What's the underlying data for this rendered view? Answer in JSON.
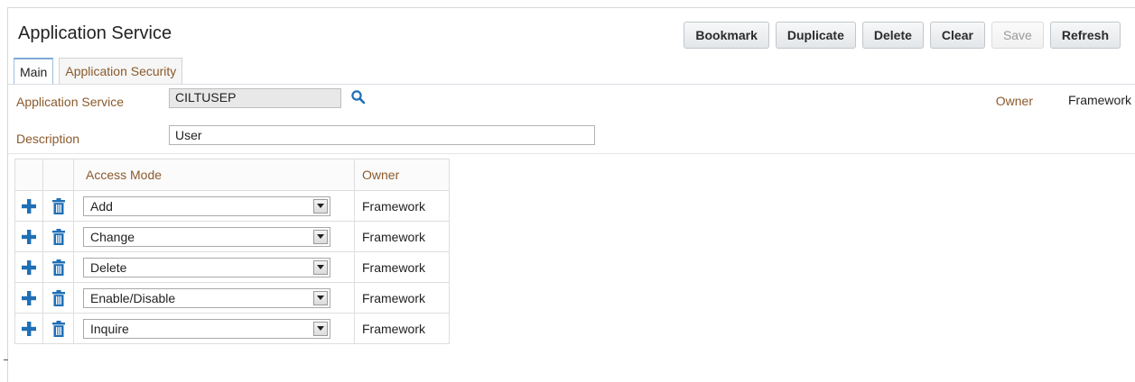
{
  "page": {
    "title": "Application Service"
  },
  "toolbar": {
    "buttons": [
      {
        "label": "Bookmark",
        "enabled": true
      },
      {
        "label": "Duplicate",
        "enabled": true
      },
      {
        "label": "Delete",
        "enabled": true
      },
      {
        "label": "Clear",
        "enabled": true
      },
      {
        "label": "Save",
        "enabled": false
      },
      {
        "label": "Refresh",
        "enabled": true
      }
    ]
  },
  "tabs": [
    {
      "label": "Main",
      "active": true
    },
    {
      "label": "Application Security",
      "active": false
    }
  ],
  "form": {
    "app_service_label": "Application Service",
    "app_service_value": "CILTUSEP",
    "owner_label": "Owner",
    "owner_value": "Framework",
    "description_label": "Description",
    "description_value": "User"
  },
  "grid": {
    "columns": {
      "access_mode": "Access Mode",
      "owner": "Owner"
    },
    "rows": [
      {
        "access_mode": "Add",
        "owner": "Framework"
      },
      {
        "access_mode": "Change",
        "owner": "Framework"
      },
      {
        "access_mode": "Delete",
        "owner": "Framework"
      },
      {
        "access_mode": "Enable/Disable",
        "owner": "Framework"
      },
      {
        "access_mode": "Inquire",
        "owner": "Framework"
      }
    ]
  },
  "colors": {
    "label_brown": "#8b5a2b",
    "icon_blue": "#1f6fb5",
    "readonly_field": "#e8e8e8"
  }
}
